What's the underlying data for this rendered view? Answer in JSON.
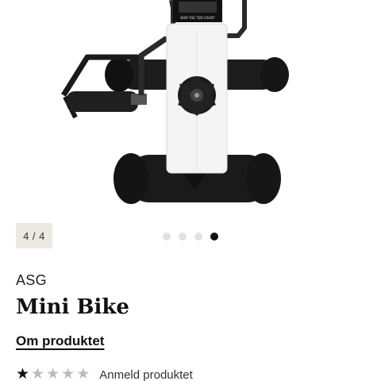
{
  "gallery": {
    "counter": "4 / 4",
    "image_count": 4,
    "active_index": 4,
    "display_text": "BOM THE TEN COUNT"
  },
  "product": {
    "brand": "ASG",
    "title": "Mini Bike",
    "about_label": "Om produktet"
  },
  "rating": {
    "value": 1,
    "max": 5,
    "review_label": "Anmeld produktet",
    "filled_color": "#111111",
    "empty_color": "#b9bcc6"
  },
  "colors": {
    "counter_bg": "#ece8e3",
    "dot_inactive": "#e6e0dc",
    "dot_active": "#111111"
  }
}
